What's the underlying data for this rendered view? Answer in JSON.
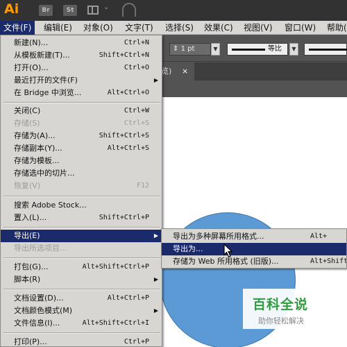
{
  "titlebar": {
    "app_logo": "Ai",
    "bridge_button": "Br",
    "stock_button": "St"
  },
  "menubar": {
    "items": [
      "文件(F)",
      "编辑(E)",
      "对象(O)",
      "文字(T)",
      "选择(S)",
      "效果(C)",
      "视图(V)",
      "窗口(W)",
      "帮助("
    ],
    "active": "文件(F)"
  },
  "controlbar": {
    "stroke_weight": "1 pt",
    "stroke_profile": "等比"
  },
  "document_tab": {
    "label": "览)",
    "close": "×"
  },
  "file_menu": {
    "items": [
      {
        "label": "新建(N)...",
        "shortcut": "Ctrl+N"
      },
      {
        "label": "从模板新建(T)...",
        "shortcut": "Shift+Ctrl+N"
      },
      {
        "label": "打开(O)...",
        "shortcut": "Ctrl+O"
      },
      {
        "label": "最近打开的文件(F)",
        "submenu": true
      },
      {
        "label": "在 Bridge 中浏览...",
        "shortcut": "Alt+Ctrl+O"
      },
      {
        "label": "关闭(C)",
        "shortcut": "Ctrl+W"
      },
      {
        "label": "存储(S)",
        "shortcut": "Ctrl+S",
        "disabled": true
      },
      {
        "label": "存储为(A)...",
        "shortcut": "Shift+Ctrl+S"
      },
      {
        "label": "存储副本(Y)...",
        "shortcut": "Alt+Ctrl+S"
      },
      {
        "label": "存储为模板..."
      },
      {
        "label": "存储选中的切片..."
      },
      {
        "label": "恢复(V)",
        "shortcut": "F12",
        "disabled": true
      },
      {
        "label": "搜索 Adobe Stock..."
      },
      {
        "label": "置入(L)...",
        "shortcut": "Shift+Ctrl+P"
      },
      {
        "label": "导出(E)",
        "submenu": true,
        "highlighted": true
      },
      {
        "label": "导出所选项目...",
        "disabled": true
      },
      {
        "label": "打包(G)...",
        "shortcut": "Alt+Shift+Ctrl+P"
      },
      {
        "label": "脚本(R)",
        "submenu": true
      },
      {
        "label": "文档设置(D)...",
        "shortcut": "Alt+Ctrl+P"
      },
      {
        "label": "文档颜色模式(M)",
        "submenu": true
      },
      {
        "label": "文件信息(I)...",
        "shortcut": "Alt+Shift+Ctrl+I"
      },
      {
        "label": "打印(P)...",
        "shortcut": "Ctrl+P"
      }
    ]
  },
  "export_submenu": {
    "items": [
      {
        "label": "导出为多种屏幕所用格式...",
        "shortcut": "Alt+"
      },
      {
        "label": "导出为...",
        "highlighted": true
      },
      {
        "label": "存储为 Web 所用格式 (旧版)...",
        "shortcut": "Alt+Shift+"
      }
    ]
  },
  "watermark": {
    "title": "百科全说",
    "subtitle": "助你轻松解决"
  },
  "colors": {
    "menu_highlight": "#1b2a6b",
    "menu_bg": "#d8d6d2",
    "artboard_circle": "#5c9ad5",
    "app_logo": "#ff9a00"
  },
  "icons": {
    "layout": "layout-grid-icon",
    "gpu": "gpu-performance-icon",
    "cursor": "arrow-cursor-icon"
  }
}
